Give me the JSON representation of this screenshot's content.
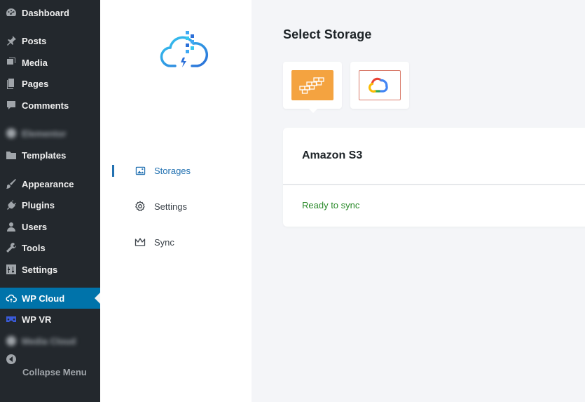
{
  "wp_sidebar": {
    "items": [
      {
        "label": "Dashboard",
        "icon": "dashboard-icon"
      },
      {
        "label": "Posts",
        "icon": "pin-icon"
      },
      {
        "label": "Media",
        "icon": "media-icon"
      },
      {
        "label": "Pages",
        "icon": "pages-icon"
      },
      {
        "label": "Comments",
        "icon": "comment-icon"
      },
      {
        "label": "Elementor",
        "icon": "elementor-icon"
      },
      {
        "label": "Templates",
        "icon": "folder-icon"
      },
      {
        "label": "Appearance",
        "icon": "brush-icon"
      },
      {
        "label": "Plugins",
        "icon": "plug-icon"
      },
      {
        "label": "Users",
        "icon": "user-icon"
      },
      {
        "label": "Tools",
        "icon": "wrench-icon"
      },
      {
        "label": "Settings",
        "icon": "settings-sliders-icon"
      },
      {
        "label": "WP Cloud",
        "icon": "cloud-sync-icon"
      },
      {
        "label": "WP VR",
        "icon": "vr-headset-icon"
      },
      {
        "label": "Media Cloud",
        "icon": "media-cloud-icon"
      }
    ],
    "collapse_label": "Collapse Menu"
  },
  "plugin_nav": {
    "items": [
      {
        "label": "Storages",
        "icon": "image-icon"
      },
      {
        "label": "Settings",
        "icon": "gear-icon"
      },
      {
        "label": "Sync",
        "icon": "crown-icon"
      }
    ]
  },
  "main": {
    "title": "Select Storage",
    "providers": [
      {
        "name": "Amazon S3",
        "icon": "aws-logo-icon",
        "accent": "#f4a340"
      },
      {
        "name": "Google Cloud",
        "icon": "google-cloud-logo-icon"
      }
    ],
    "selected_provider": "Amazon S3",
    "status": "Ready to sync",
    "status_color": "#2a8a2a"
  },
  "colors": {
    "wp_sidebar_bg": "#23282d",
    "wp_active": "#0073aa",
    "accent": "#2271b1"
  }
}
